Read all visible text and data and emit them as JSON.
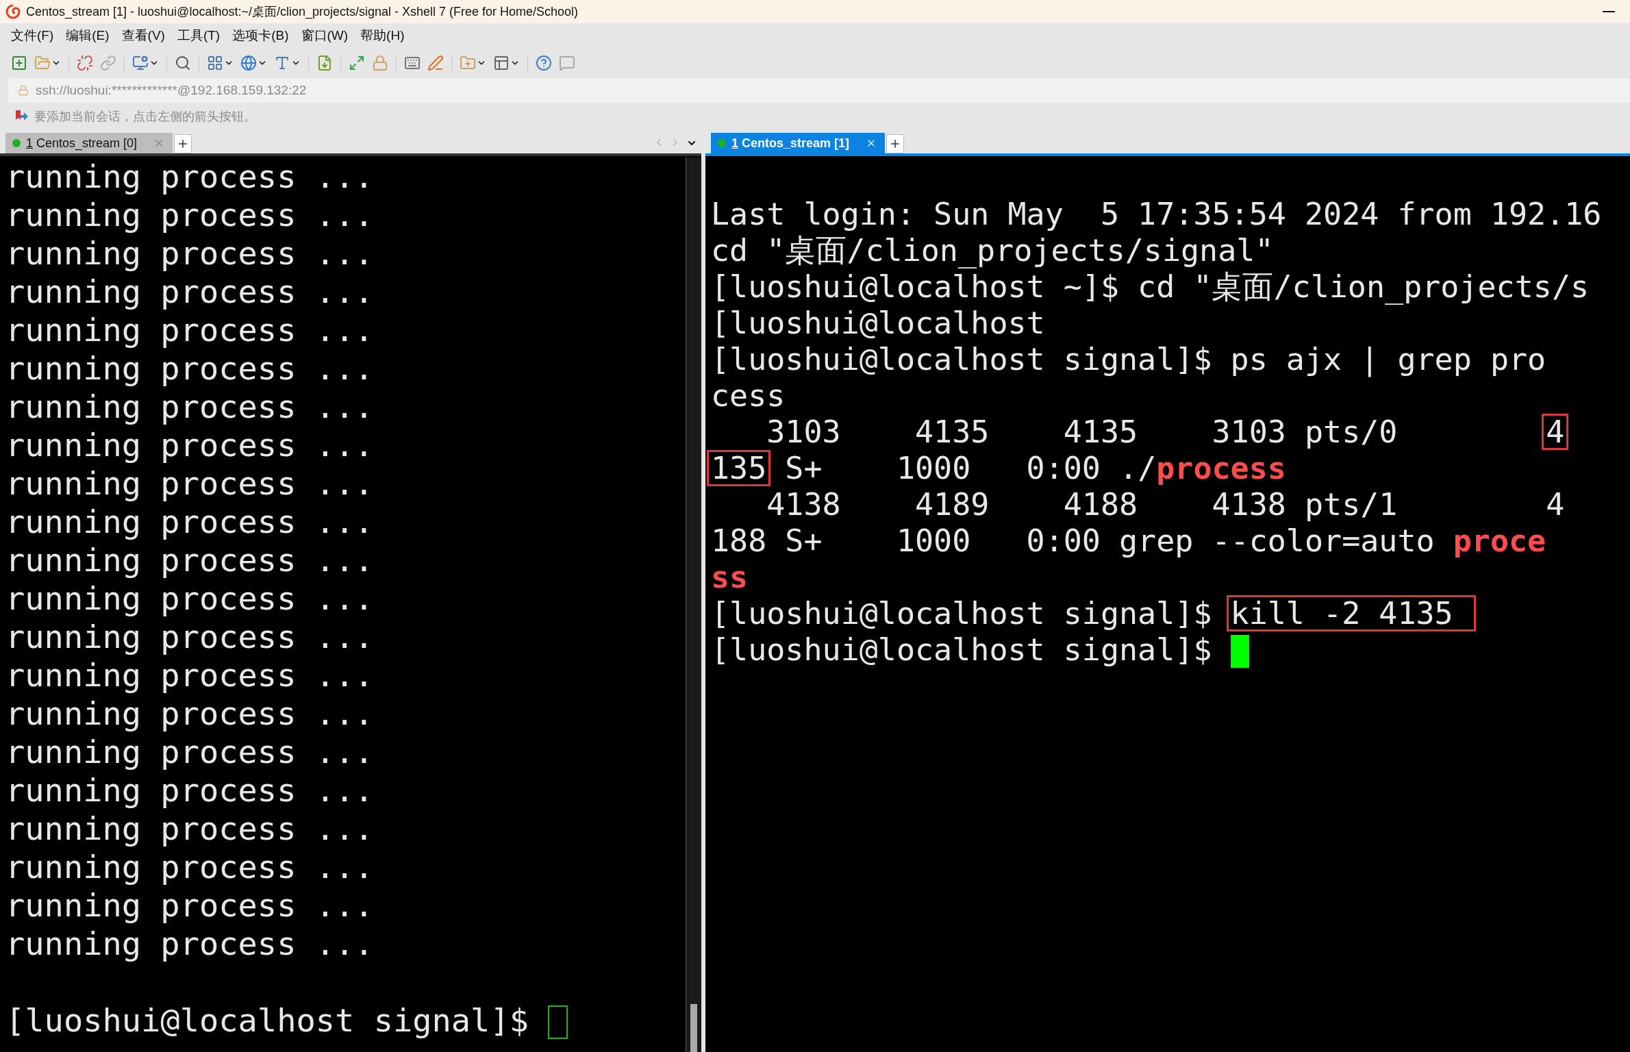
{
  "window": {
    "title": "Centos_stream [1] - luoshui@localhost:~/桌面/clion_projects/signal - Xshell 7 (Free for Home/School)"
  },
  "menu": [
    "文件(F)",
    "编辑(E)",
    "查看(V)",
    "工具(T)",
    "选项卡(B)",
    "窗口(W)",
    "帮助(H)"
  ],
  "address_bar": {
    "value": "ssh://luoshui:*************@192.168.159.132:22"
  },
  "hint_bar": {
    "text": "要添加当前会话，点击左侧的箭头按钮。"
  },
  "panes": [
    {
      "tab": {
        "number": "1",
        "title": "Centos_stream [0]",
        "selected": false
      },
      "cursor_filled": false,
      "lines": [
        [
          {
            "kind": "text",
            "text": "running process ..."
          }
        ],
        [
          {
            "kind": "text",
            "text": "running process ..."
          }
        ],
        [
          {
            "kind": "text",
            "text": "running process ..."
          }
        ],
        [
          {
            "kind": "text",
            "text": "running process ..."
          }
        ],
        [
          {
            "kind": "text",
            "text": "running process ..."
          }
        ],
        [
          {
            "kind": "text",
            "text": "running process ..."
          }
        ],
        [
          {
            "kind": "text",
            "text": "running process ..."
          }
        ],
        [
          {
            "kind": "text",
            "text": "running process ..."
          }
        ],
        [
          {
            "kind": "text",
            "text": "running process ..."
          }
        ],
        [
          {
            "kind": "text",
            "text": "running process ..."
          }
        ],
        [
          {
            "kind": "text",
            "text": "running process ..."
          }
        ],
        [
          {
            "kind": "text",
            "text": "running process ..."
          }
        ],
        [
          {
            "kind": "text",
            "text": "running process ..."
          }
        ],
        [
          {
            "kind": "text",
            "text": "running process ..."
          }
        ],
        [
          {
            "kind": "text",
            "text": "running process ..."
          }
        ],
        [
          {
            "kind": "text",
            "text": "running process ..."
          }
        ],
        [
          {
            "kind": "text",
            "text": "running process ..."
          }
        ],
        [
          {
            "kind": "text",
            "text": "running process ..."
          }
        ],
        [
          {
            "kind": "text",
            "text": "running process ..."
          }
        ],
        [
          {
            "kind": "text",
            "text": "running process ..."
          }
        ],
        [
          {
            "kind": "text",
            "text": "running process ..."
          }
        ]
      ],
      "prompt": "[luoshui@localhost signal]$ "
    },
    {
      "tab": {
        "number": "1",
        "title": "Centos_stream [1]",
        "selected": true
      },
      "cursor_filled": true,
      "lines": [
        [
          {
            "kind": "text",
            "text": "Last login: Sun May  5 17:35:54 2024 from 192.16"
          }
        ],
        [
          {
            "kind": "text",
            "text": "cd \"桌面/clion_projects/signal\""
          }
        ],
        [
          {
            "kind": "text",
            "text": "[luoshui@localhost ~]$ cd \"桌面/clion_projects/s"
          }
        ],
        [
          {
            "kind": "text",
            "text": "[luoshui@localhost"
          }
        ],
        [
          {
            "kind": "text",
            "text": "[luoshui@localhost signal]$ ps ajx | grep pro"
          }
        ],
        [
          {
            "kind": "text",
            "text": "cess"
          }
        ],
        [
          {
            "kind": "text",
            "text": "   3103    4135    4135    3103 pts/0        "
          },
          {
            "kind": "boxed",
            "text": "4"
          }
        ],
        [
          {
            "kind": "boxed",
            "text": "135"
          },
          {
            "kind": "text",
            "text": " S+    1000   0:00 ./"
          },
          {
            "kind": "match",
            "text": "process"
          }
        ],
        [
          {
            "kind": "text",
            "text": "   4138    4189    4188    4138 pts/1        4"
          }
        ],
        [
          {
            "kind": "text",
            "text": "188 S+    1000   0:00 grep --color=auto "
          },
          {
            "kind": "match",
            "text": "proce"
          }
        ],
        [
          {
            "kind": "match",
            "text": "ss"
          }
        ],
        [
          {
            "kind": "text",
            "text": "[luoshui@localhost signal]$ "
          },
          {
            "kind": "boxed",
            "text": "kill -2 4135 "
          }
        ]
      ],
      "prompt": "[luoshui@localhost signal]$ "
    }
  ]
}
